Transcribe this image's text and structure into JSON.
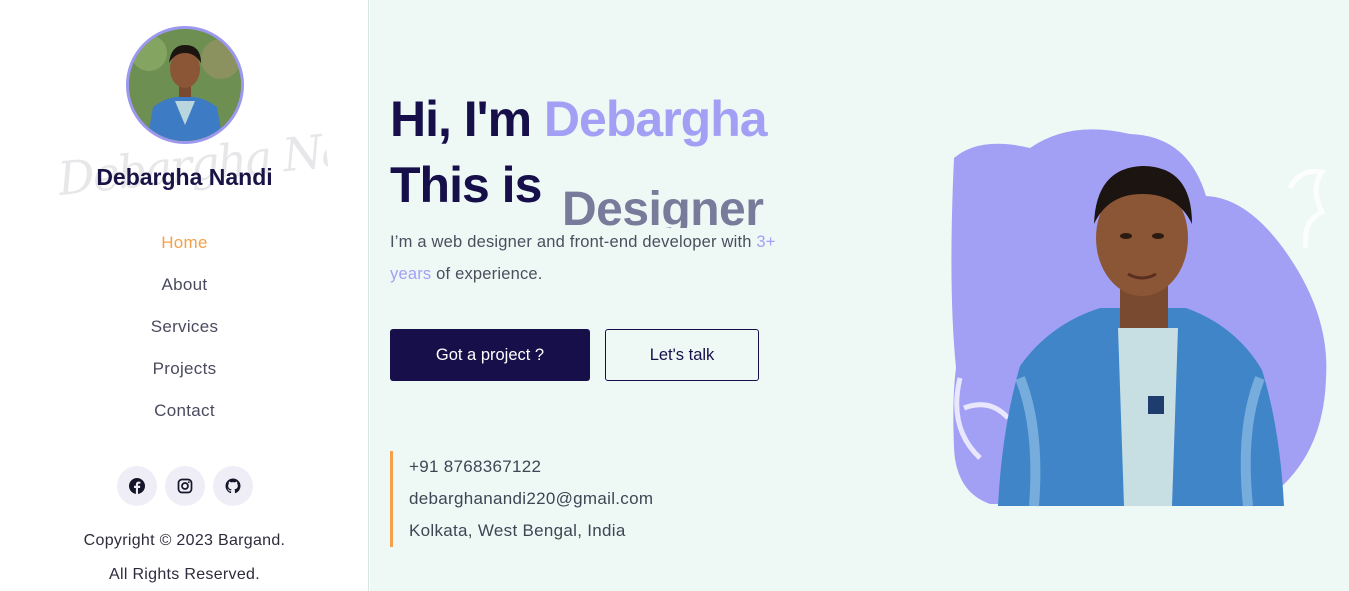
{
  "sidebar": {
    "name": "Debargha Nandi",
    "signature": "Debargha Nandi",
    "nav": [
      {
        "label": "Home",
        "active": true
      },
      {
        "label": "About",
        "active": false
      },
      {
        "label": "Services",
        "active": false
      },
      {
        "label": "Projects",
        "active": false
      },
      {
        "label": "Contact",
        "active": false
      }
    ],
    "socials": [
      "facebook-icon",
      "instagram-icon",
      "github-icon"
    ],
    "copyright_line1": "Copyright © 2023 Bargand.",
    "copyright_line2": "All Rights Reserved."
  },
  "hero": {
    "greeting": "Hi, I'm ",
    "name": "Debargha",
    "this_is": "This is",
    "role": "Designer",
    "intro_part1": "I’m a web designer and front-end developer with ",
    "intro_highlight": "3+ years",
    "intro_part2": " of experience.",
    "primary_button": "Got a project ?",
    "secondary_button": "Let's talk"
  },
  "contact": {
    "phone": "+91 8768367122",
    "email": "debarghanandi220@gmail.com",
    "location": "Kolkata, West Bengal, India"
  },
  "colors": {
    "navy": "#160f4a",
    "accent_purple": "#a2a0f5",
    "accent_orange": "#f4a04c",
    "main_bg": "#eef9f6"
  }
}
